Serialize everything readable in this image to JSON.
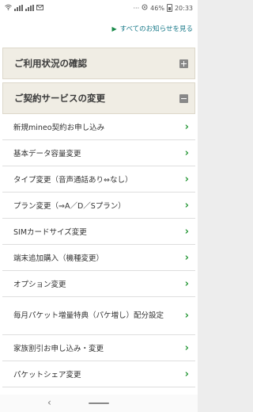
{
  "status": {
    "battery_text": "46%",
    "time": "20:33",
    "dots": "···"
  },
  "notice_link": {
    "label": "すべてのお知らせを見る"
  },
  "sections": [
    {
      "title": "ご利用状況の確認",
      "expanded": false,
      "toggle_icon": "plus-icon"
    },
    {
      "title": "ご契約サービスの変更",
      "expanded": true,
      "toggle_icon": "minus-icon"
    }
  ],
  "items": [
    {
      "label": "新規mineo契約お申し込み"
    },
    {
      "label": "基本データ容量変更"
    },
    {
      "label": "タイプ変更（音声通話あり⇔なし）"
    },
    {
      "label": "プラン変更（⇒A／D／Sプラン）"
    },
    {
      "label": "SIMカードサイズ変更"
    },
    {
      "label": "端末追加購入（機種変更）"
    },
    {
      "label": "オプション変更"
    },
    {
      "label": "毎月パケット増量特典（パケ増し）配分設定"
    },
    {
      "label": "家族割引お申し込み・変更"
    },
    {
      "label": "パケットシェア変更"
    }
  ],
  "colors": {
    "chevron": "#2c9a3c",
    "link": "#1a7a8a",
    "section_bg": "#f0ede4"
  }
}
